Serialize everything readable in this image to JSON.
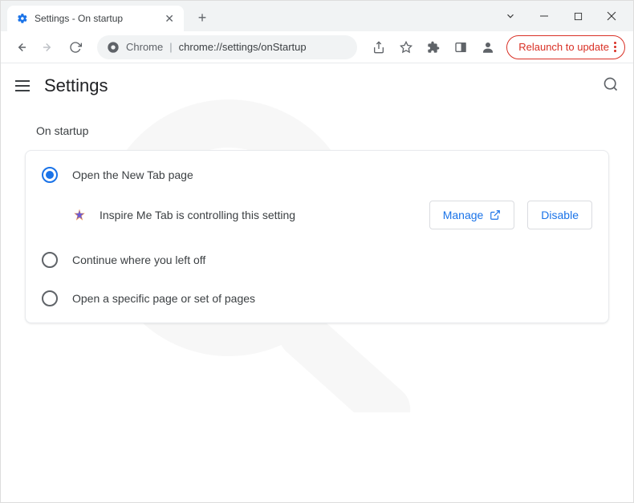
{
  "tab": {
    "title": "Settings - On startup"
  },
  "address": {
    "protocol": "Chrome",
    "path": "chrome://settings/onStartup"
  },
  "toolbar": {
    "update_label": "Relaunch to update"
  },
  "page": {
    "title": "Settings"
  },
  "section": {
    "title": "On startup",
    "options": [
      {
        "label": "Open the New Tab page",
        "selected": true
      },
      {
        "label": "Continue where you left off",
        "selected": false
      },
      {
        "label": "Open a specific page or set of pages",
        "selected": false
      }
    ],
    "extension": {
      "message": "Inspire Me Tab is controlling this setting",
      "manage_label": "Manage",
      "disable_label": "Disable"
    }
  }
}
